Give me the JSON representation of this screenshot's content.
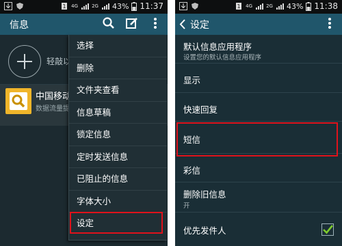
{
  "left_screen": {
    "status": {
      "time": "11:37",
      "battery": "43%",
      "network_a": "4G",
      "network_b": "2G"
    },
    "header": {
      "title": "信息"
    },
    "compose": {
      "label": "轻敲以"
    },
    "conversation": {
      "name": "中国移动",
      "preview": "数据流量提"
    },
    "menu": {
      "items": [
        "选择",
        "删除",
        "文件夹查看",
        "信息草稿",
        "锁定信息",
        "定时发送信息",
        "已阻止的信息",
        "字体大小",
        "设定"
      ]
    }
  },
  "right_screen": {
    "status": {
      "time": "11:38",
      "battery": "43%",
      "network_a": "4G",
      "network_b": "2G"
    },
    "header": {
      "title": "设定"
    },
    "settings": [
      {
        "label": "默认信息应用程序",
        "sub": "设置您的默认信息应用程序"
      },
      {
        "label": "显示"
      },
      {
        "label": "快速回复"
      },
      {
        "label": "短信"
      },
      {
        "label": "彩信"
      },
      {
        "label": "删除旧信息",
        "sub": "开"
      },
      {
        "label": "优先发件人",
        "checked": true
      }
    ]
  },
  "colors": {
    "highlight": "#e0121b",
    "appbar": "#20566b",
    "checkbox": "#7ecb2e"
  }
}
